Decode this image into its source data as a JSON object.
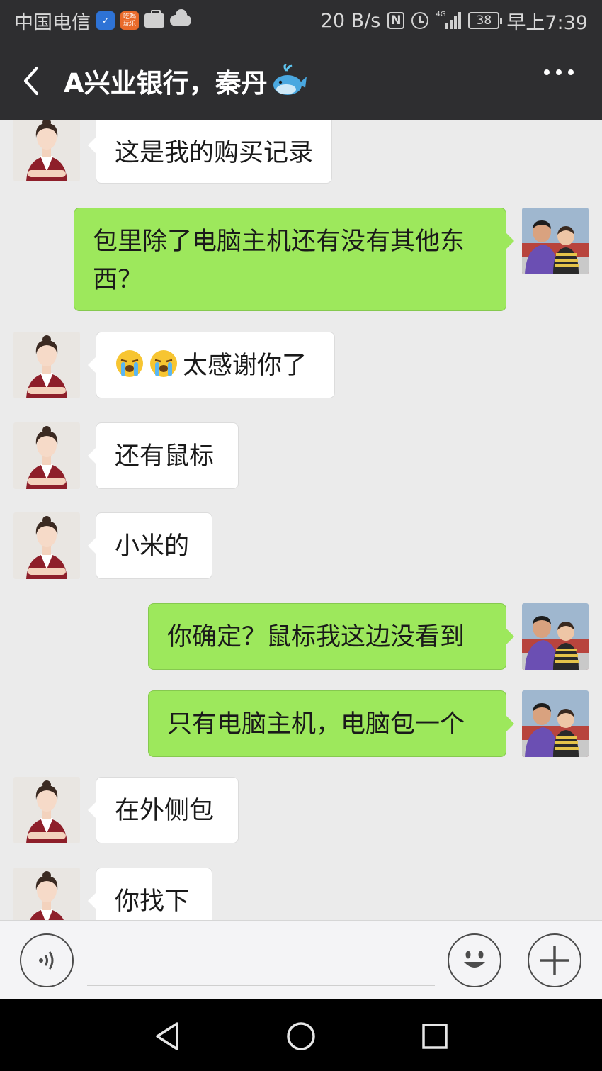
{
  "status_bar": {
    "carrier": "中国电信",
    "game_badge": "吃喝玩乐",
    "speed": "20 B/s",
    "network": "4G",
    "nfc": "N",
    "battery": "38",
    "time": "早上7:39"
  },
  "header": {
    "title": "A兴业银行，秦丹",
    "title_emoji_icon": "whale-icon",
    "back_icon": "chevron-left-icon",
    "more_icon": "more-dots-icon"
  },
  "messages": [
    {
      "side": "left",
      "text": "这是我的购买记录"
    },
    {
      "side": "right",
      "text": "包里除了电脑主机还有没有其他东西？"
    },
    {
      "side": "left",
      "text": "太感谢你了",
      "emoji": [
        "crying-face-icon",
        "crying-face-icon"
      ]
    },
    {
      "side": "left",
      "text": "还有鼠标"
    },
    {
      "side": "left",
      "text": "小米的"
    },
    {
      "side": "right",
      "text": "你确定？鼠标我这边没看到"
    },
    {
      "side": "right",
      "text": "只有电脑主机，电脑包一个"
    },
    {
      "side": "left",
      "text": "在外侧包"
    },
    {
      "side": "left",
      "text": "你找下"
    }
  ],
  "input_bar": {
    "voice_icon": "voice-icon",
    "emoji_icon": "smiley-icon",
    "plus_icon": "plus-icon",
    "input_value": ""
  },
  "colors": {
    "header_bg": "#2e2e30",
    "chat_bg": "#ebebeb",
    "sent_bubble": "#9de85c",
    "received_bubble": "#ffffff"
  }
}
